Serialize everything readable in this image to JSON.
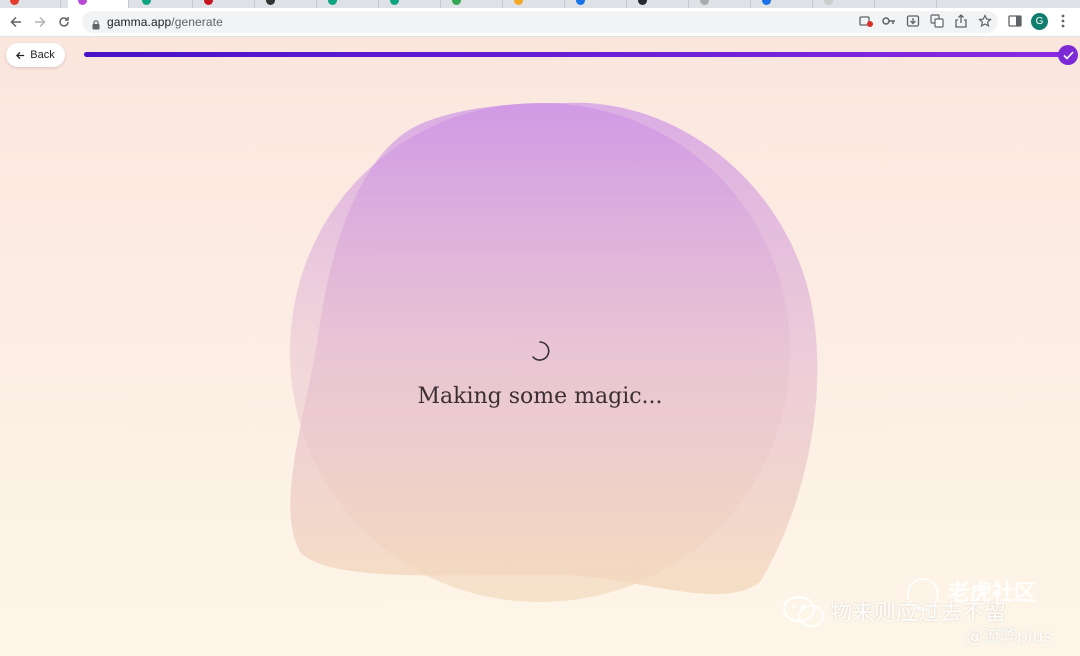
{
  "browser": {
    "url_host": "gamma.app",
    "url_path": "/generate",
    "profile_initial": "G"
  },
  "page": {
    "back_label": "Back",
    "progress_percent": 100,
    "loading_text": "Making some magic...",
    "colors": {
      "progress_start": "#4a11c8",
      "progress_end": "#8a2be2",
      "blob_top": "#d39be6",
      "blob_bottom": "#f4d6b6"
    }
  },
  "watermark": {
    "site": "老虎社区",
    "caption": "物来则应过去不留",
    "handle": "@流弊plus"
  }
}
